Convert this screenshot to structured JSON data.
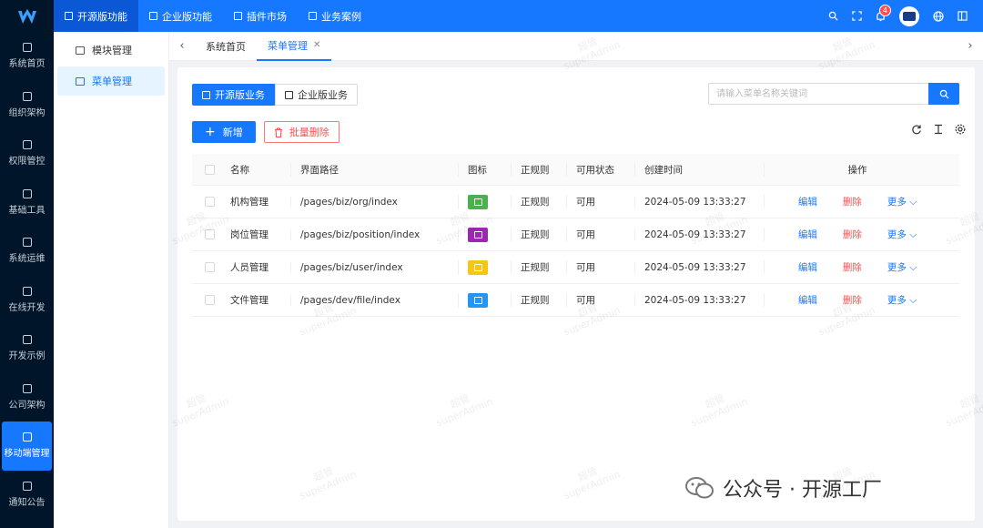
{
  "colors": {
    "primary": "#1677ff",
    "sidebar_dark": "#001529",
    "danger": "#ff4d4f"
  },
  "leftbar": {
    "items": [
      {
        "label": "系统首页",
        "icon": "home-icon"
      },
      {
        "label": "组织架构",
        "icon": "org-icon"
      },
      {
        "label": "权限管控",
        "icon": "user-icon"
      },
      {
        "label": "基础工具",
        "icon": "tool-icon"
      },
      {
        "label": "系统运维",
        "icon": "doc-icon"
      },
      {
        "label": "在线开发",
        "icon": "code-icon"
      },
      {
        "label": "开发示例",
        "icon": "layout-icon"
      },
      {
        "label": "公司架构",
        "icon": "cluster-icon"
      },
      {
        "label": "移动端管理",
        "icon": "mobile-icon",
        "active": true
      },
      {
        "label": "通知公告",
        "icon": "grid-icon"
      }
    ]
  },
  "topbar": {
    "nav": [
      {
        "label": "开源版功能",
        "active": true
      },
      {
        "label": "企业版功能"
      },
      {
        "label": "插件市场"
      },
      {
        "label": "业务案例"
      }
    ],
    "notification_count": "4"
  },
  "subbar": {
    "items": [
      {
        "label": "模块管理"
      },
      {
        "label": "菜单管理",
        "active": true
      }
    ]
  },
  "tabs": [
    {
      "label": "系统首页"
    },
    {
      "label": "菜单管理",
      "active": true
    }
  ],
  "segment": {
    "opensource": "开源版业务",
    "enterprise": "企业版业务"
  },
  "search": {
    "placeholder": "请输入菜单名称关键词"
  },
  "toolbar": {
    "add": "新增",
    "batch_delete": "批量删除"
  },
  "table": {
    "headers": {
      "name": "名称",
      "path": "界面路径",
      "icon": "图标",
      "rule": "正规则",
      "status": "可用状态",
      "time": "创建时间",
      "ops": "操作"
    },
    "rows": [
      {
        "name": "机构管理",
        "path": "/pages/biz/org/index",
        "icon_color": "#4caf50",
        "rule": "正规则",
        "status": "可用",
        "time": "2024-05-09 13:33:27"
      },
      {
        "name": "岗位管理",
        "path": "/pages/biz/position/index",
        "icon_color": "#9c27b0",
        "rule": "正规则",
        "status": "可用",
        "time": "2024-05-09 13:33:27"
      },
      {
        "name": "人员管理",
        "path": "/pages/biz/user/index",
        "icon_color": "#f5c518",
        "rule": "正规则",
        "status": "可用",
        "time": "2024-05-09 13:33:27"
      },
      {
        "name": "文件管理",
        "path": "/pages/dev/file/index",
        "icon_color": "#2196f3",
        "rule": "正规则",
        "status": "可用",
        "time": "2024-05-09 13:33:27"
      }
    ],
    "ops": {
      "edit": "编辑",
      "delete": "删除",
      "more": "更多"
    }
  },
  "watermark": {
    "line1": "超管",
    "line2": "superAdmin"
  },
  "brand": {
    "text": "公众号 · 开源工厂"
  }
}
